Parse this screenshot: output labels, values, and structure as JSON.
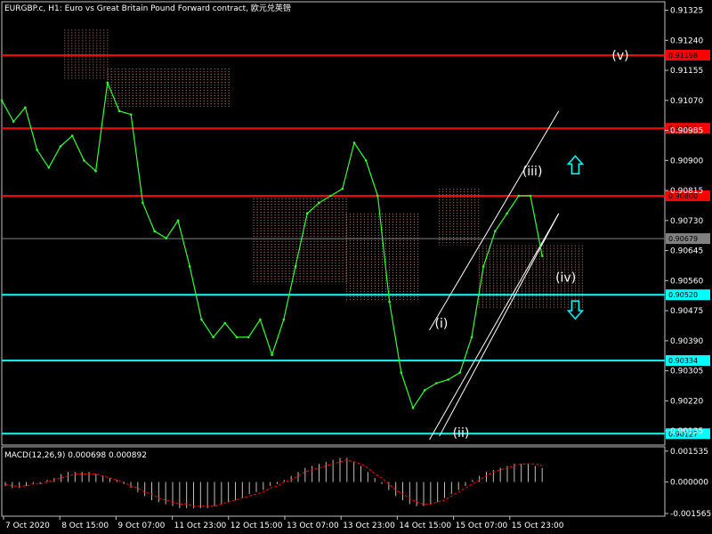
{
  "chart_title": "EURGBP.c, H1:  Euro vs Great Britain Pound Forward contract, 欧元兑英镑",
  "macd_title": "MACD(12,26,9) 0.000698 0.000892",
  "chart_data": [
    {
      "type": "line",
      "title": "EURGBP.c, H1:  Euro vs Great Britain Pound Forward contract, 欧元兑英镑",
      "price_axis_ticks": [
        "0.91325",
        "0.91240",
        "0.91155",
        "0.91070",
        "0.90985",
        "0.90900",
        "0.90815",
        "0.90730",
        "0.90645",
        "0.90560",
        "0.90475",
        "0.90390",
        "0.90305",
        "0.90220",
        "0.90135"
      ],
      "ylim": [
        0.90095,
        0.91349
      ],
      "time_axis_labels": [
        "7 Oct 2020",
        "8 Oct 15:00",
        "9 Oct 07:00",
        "11 Oct 23:00",
        "12 Oct 15:00",
        "13 Oct 07:00",
        "13 Oct 23:00",
        "14 Oct 15:00",
        "15 Oct 07:00",
        "15 Oct 23:00"
      ],
      "horizontal_levels": [
        {
          "value": "0.91198",
          "color": "#ff0000"
        },
        {
          "value": "0.90991",
          "color": "#ff0000"
        },
        {
          "value": "0.90800",
          "color": "#ff0000"
        },
        {
          "value": "0.90679",
          "color": "#808080"
        },
        {
          "value": "0.90520",
          "color": "#00ffff"
        },
        {
          "value": "0.90334",
          "color": "#00ffff"
        },
        {
          "value": "0.90127",
          "color": "#00ffff"
        }
      ],
      "series": [
        {
          "values": [
            0.9107,
            0.9101,
            0.9105,
            0.9093,
            0.9088,
            0.9094,
            0.9097,
            0.909,
            0.9087,
            0.9112,
            0.9104,
            0.9103,
            0.9078,
            0.907,
            0.9068,
            0.9073,
            0.906,
            0.9045,
            0.904,
            0.9044,
            0.904,
            0.904,
            0.9045,
            0.9035,
            0.9045,
            0.906,
            0.9075,
            0.9078,
            0.908,
            0.9082,
            0.9095,
            0.909,
            0.908,
            0.905,
            0.903,
            0.902,
            0.9025,
            0.9027,
            0.9028,
            0.903,
            0.904,
            0.906,
            0.907,
            0.9075,
            0.908,
            0.908,
            0.9063
          ]
        }
      ],
      "ichimoku_cloud": [
        {
          "x": [
            0.095,
            0.16
          ],
          "top": 0.9127,
          "bottom": 0.9113
        },
        {
          "x": [
            0.16,
            0.345
          ],
          "top": 0.9116,
          "bottom": 0.9105
        },
        {
          "x": [
            0.38,
            0.52
          ],
          "top": 0.908,
          "bottom": 0.9055
        },
        {
          "x": [
            0.52,
            0.63
          ],
          "top": 0.9075,
          "bottom": 0.905
        },
        {
          "x": [
            0.66,
            0.72
          ],
          "top": 0.9082,
          "bottom": 0.9066
        },
        {
          "x": [
            0.72,
            0.88
          ],
          "top": 0.9066,
          "bottom": 0.9048
        }
      ],
      "wave_labels": [
        {
          "label": "(v)",
          "x": 0.92,
          "y": 0.91198
        },
        {
          "label": "(iii)",
          "x": 0.785,
          "y": 0.9087
        },
        {
          "label": "(iv)",
          "x": 0.835,
          "y": 0.9057
        },
        {
          "label": "(i)",
          "x": 0.653,
          "y": 0.9044
        },
        {
          "label": "(ii)",
          "x": 0.68,
          "y": 0.9013
        }
      ],
      "arrows": [
        {
          "name": "up-arrow",
          "x": 0.865,
          "y": 0.90885,
          "color": "#00ffff"
        },
        {
          "name": "down-arrow",
          "x": 0.865,
          "y": 0.9048,
          "color": "#00ffff"
        }
      ],
      "channel_lines": [
        {
          "from": [
            0.645,
            0.9042
          ],
          "to": [
            0.84,
            0.9104
          ]
        },
        {
          "from": [
            0.66,
            0.9012
          ],
          "to": [
            0.84,
            0.9075
          ]
        },
        {
          "from": [
            0.645,
            0.9011
          ],
          "to": [
            0.84,
            0.9075
          ]
        }
      ]
    },
    {
      "type": "bar",
      "title": "MACD(12,26,9) 0.000698 0.000892",
      "axis_ticks": [
        "0.001535",
        "0.000000",
        "-0.001565"
      ],
      "ylim": [
        -0.0017,
        0.00175
      ],
      "histogram": [
        -0.0002,
        -0.0003,
        -0.0003,
        -0.0002,
        -0.0001,
        -0.0001,
        0.0001,
        0.0002,
        0.0004,
        0.0005,
        0.0005,
        0.0005,
        0.0005,
        0.0004,
        0.0003,
        0.0002,
        0.0001,
        -0.0001,
        -0.0003,
        -0.0005,
        -0.0007,
        -0.0009,
        -0.001,
        -0.0011,
        -0.0012,
        -0.0013,
        -0.0013,
        -0.0013,
        -0.0013,
        -0.0013,
        -0.0012,
        -0.0011,
        -0.001,
        -0.0009,
        -0.0008,
        -0.0006,
        -0.0005,
        -0.0004,
        -0.0002,
        -0.0001,
        0.0001,
        0.0003,
        0.0005,
        0.0007,
        0.0008,
        0.0009,
        0.001,
        0.0011,
        0.0012,
        0.0012,
        0.001,
        0.0008,
        0.0005,
        0.0002,
        -0.0001,
        -0.0004,
        -0.0007,
        -0.0009,
        -0.0011,
        -0.0012,
        -0.0012,
        -0.0011,
        -0.001,
        -0.0008,
        -0.0006,
        -0.0004,
        -0.0002,
        0.0001,
        0.0003,
        0.0005,
        0.0006,
        0.0007,
        0.0008,
        0.0009,
        0.0009,
        0.0009,
        0.0008,
        0.0007
      ],
      "signal": [
        -0.0001,
        -0.0002,
        -0.0002,
        -0.0002,
        -0.0001,
        -0.0001,
        0.0,
        0.0001,
        0.0002,
        0.0003,
        0.0004,
        0.0004,
        0.0004,
        0.0004,
        0.0003,
        0.0002,
        0.0001,
        0.0,
        -0.0002,
        -0.0003,
        -0.0005,
        -0.0006,
        -0.0008,
        -0.0009,
        -0.001,
        -0.0011,
        -0.0011,
        -0.0012,
        -0.0012,
        -0.0012,
        -0.0012,
        -0.0011,
        -0.001,
        -0.0009,
        -0.0008,
        -0.0007,
        -0.0006,
        -0.0005,
        -0.0003,
        -0.0002,
        0.0,
        0.0001,
        0.0003,
        0.0005,
        0.0006,
        0.0007,
        0.0008,
        0.0009,
        0.001,
        0.0011,
        0.001,
        0.0009,
        0.0007,
        0.0004,
        0.0002,
        -0.0001,
        -0.0004,
        -0.0006,
        -0.0008,
        -0.001,
        -0.0011,
        -0.0011,
        -0.001,
        -0.0009,
        -0.0007,
        -0.0005,
        -0.0003,
        -0.0001,
        0.0001,
        0.0003,
        0.0005,
        0.0006,
        0.0007,
        0.0008,
        0.0009,
        0.0009,
        0.0009,
        0.0008
      ]
    }
  ]
}
